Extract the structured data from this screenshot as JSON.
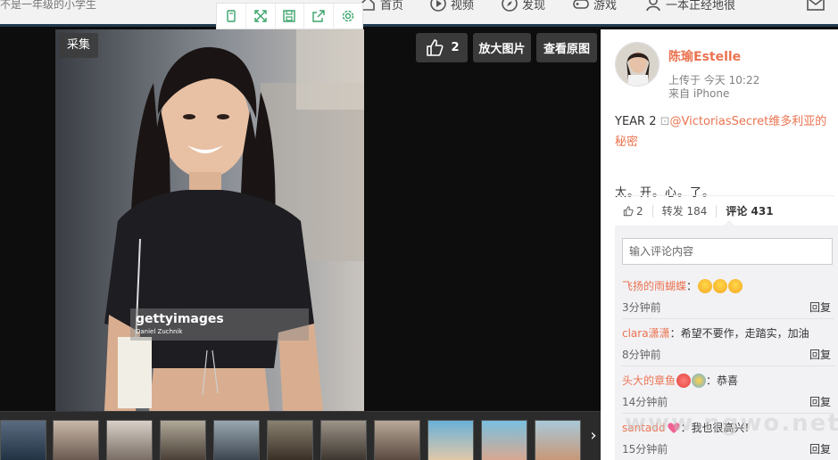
{
  "nav": {
    "hint": "不是一年级的小学生",
    "items": [
      {
        "label": "首页",
        "icon": "home-icon"
      },
      {
        "label": "视频",
        "icon": "video-icon"
      },
      {
        "label": "发现",
        "icon": "compass-icon"
      },
      {
        "label": "游戏",
        "icon": "gamepad-icon"
      },
      {
        "label": "一本正经地很",
        "icon": "user-icon"
      }
    ]
  },
  "viewer": {
    "collect_label": "采集",
    "like_count": "2",
    "zoom_label": "放大图片",
    "original_label": "查看原图",
    "watermark_brand": "gettyimages",
    "watermark_credit": "Daniel Zuchnik",
    "next_label": "›"
  },
  "user": {
    "name": "陈瑜Estelle",
    "upload_time": "上传于 今天 10:22",
    "source": "来自 iPhone"
  },
  "post": {
    "prefix": "YEAR 2 ",
    "mention": "@VictoriasSecret维多利亚的秘密",
    "line2": "太。开。心。了。"
  },
  "actions": {
    "like_count": "2",
    "repost_label": "转发 184",
    "comment_label": "评论 431"
  },
  "comments": {
    "placeholder": "输入评论内容",
    "items": [
      {
        "user": "飞扬的雨蝴蝶",
        "text": "：",
        "time": "3分钟前",
        "reply": "回复"
      },
      {
        "user": "clara潇潇",
        "text": "：希望不要作，走踏实，加油",
        "time": "8分钟前",
        "reply": "回复"
      },
      {
        "user": "头大的章鱼",
        "text": "：恭喜",
        "time": "14分钟前",
        "reply": "回复"
      },
      {
        "user": "santadd",
        "text": "：我也很高兴!",
        "time": "15分钟前",
        "reply": "回复"
      }
    ]
  },
  "site_watermark": "www.ngwo.net",
  "colors": {
    "accent": "#eb7350",
    "nav_bar": "#203a4d"
  }
}
